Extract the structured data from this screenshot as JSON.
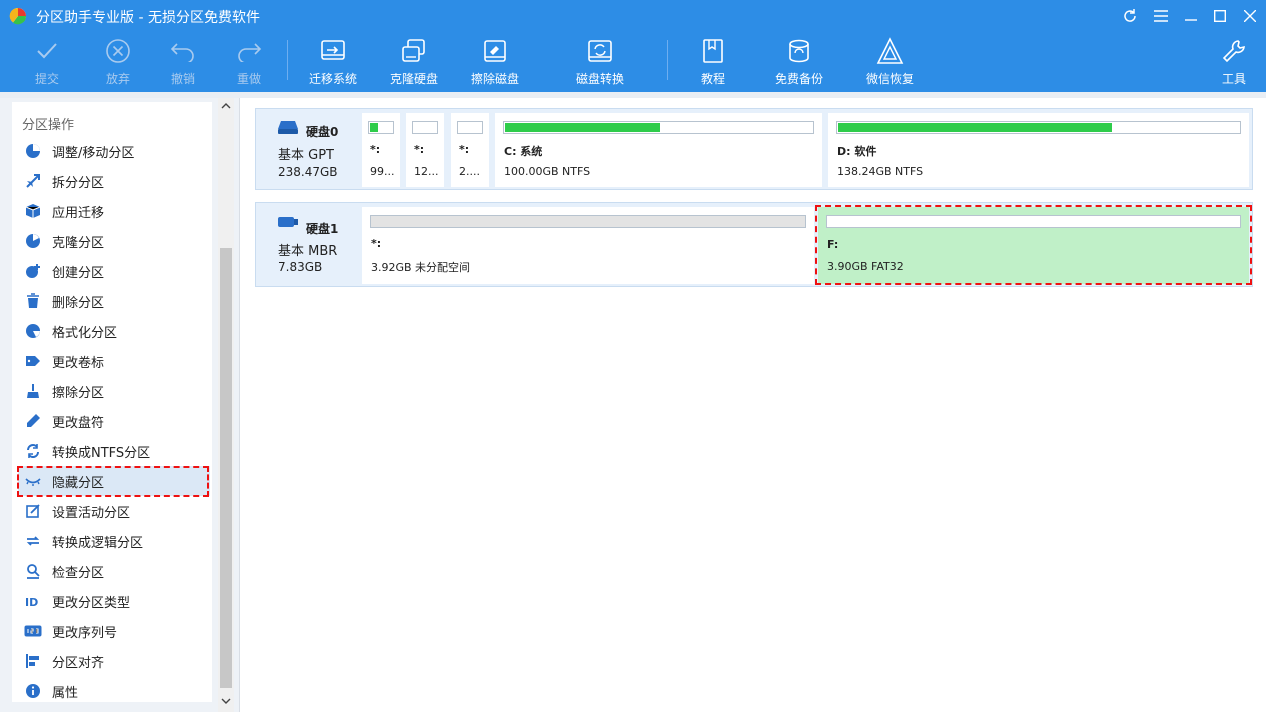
{
  "app": {
    "title": "分区助手专业版 - 无损分区免费软件"
  },
  "toolbar": {
    "buttons": [
      {
        "label": "提交",
        "icon": "check-icon",
        "enabled": false
      },
      {
        "label": "放弃",
        "icon": "cancel-circle-icon",
        "enabled": false
      },
      {
        "label": "撤销",
        "icon": "undo-icon",
        "enabled": false
      },
      {
        "label": "重做",
        "icon": "redo-icon",
        "enabled": false
      },
      {
        "label": "迁移系统",
        "icon": "migrate-os-icon",
        "enabled": true
      },
      {
        "label": "克隆硬盘",
        "icon": "clone-disk-icon",
        "enabled": true
      },
      {
        "label": "擦除磁盘",
        "icon": "wipe-disk-icon",
        "enabled": true
      },
      {
        "label": "磁盘转换",
        "icon": "disk-convert-icon",
        "enabled": true
      },
      {
        "label": "教程",
        "icon": "book-icon",
        "enabled": true
      },
      {
        "label": "免费备份",
        "icon": "backup-icon",
        "enabled": true
      },
      {
        "label": "微信恢复",
        "icon": "recovery-icon",
        "enabled": true
      },
      {
        "label": "工具",
        "icon": "tools-icon",
        "enabled": true
      }
    ]
  },
  "sidebar": {
    "title": "分区操作",
    "items": [
      {
        "label": "调整/移动分区",
        "icon": "resize-pie-icon"
      },
      {
        "label": "拆分分区",
        "icon": "split-icon"
      },
      {
        "label": "应用迁移",
        "icon": "app-move-icon"
      },
      {
        "label": "克隆分区",
        "icon": "clone-partition-icon"
      },
      {
        "label": "创建分区",
        "icon": "create-partition-icon"
      },
      {
        "label": "删除分区",
        "icon": "trash-icon"
      },
      {
        "label": "格式化分区",
        "icon": "format-icon"
      },
      {
        "label": "更改卷标",
        "icon": "tag-icon"
      },
      {
        "label": "擦除分区",
        "icon": "broom-icon"
      },
      {
        "label": "更改盘符",
        "icon": "pencil-icon"
      },
      {
        "label": "转换成NTFS分区",
        "icon": "convert-icon"
      },
      {
        "label": "隐藏分区",
        "icon": "hide-eye-icon"
      },
      {
        "label": "设置活动分区",
        "icon": "set-active-icon"
      },
      {
        "label": "转换成逻辑分区",
        "icon": "convert-logical-icon"
      },
      {
        "label": "检查分区",
        "icon": "magnifier-icon"
      },
      {
        "label": "更改分区类型",
        "icon": "id-icon"
      },
      {
        "label": "更改序列号",
        "icon": "serial-number-icon"
      },
      {
        "label": "分区对齐",
        "icon": "align-icon"
      },
      {
        "label": "属性",
        "icon": "info-icon"
      }
    ],
    "selected_index": 11
  },
  "disks": [
    {
      "name": "硬盘0",
      "type": "基本 GPT",
      "size": "238.47GB",
      "partitions": [
        {
          "label": "*:",
          "info": "99...",
          "used_fraction": 0.3
        },
        {
          "label": "*:",
          "info": "12...",
          "used_fraction": 0
        },
        {
          "label": "*:",
          "info": "2....",
          "used_fraction": 0
        },
        {
          "label": "C: 系统",
          "info": "100.00GB NTFS",
          "used_fraction": 0.5
        },
        {
          "label": "D: 软件",
          "info": "138.24GB NTFS",
          "used_fraction": 0.68
        }
      ]
    },
    {
      "name": "硬盘1",
      "type": "基本 MBR",
      "size": "7.83GB",
      "partitions": [
        {
          "label": "*:",
          "info": "3.92GB 未分配空间",
          "used_fraction": 0
        },
        {
          "label": "F:",
          "info": "3.90GB FAT32",
          "used_fraction": 0
        }
      ]
    }
  ],
  "colors": {
    "accent": "#2d8de6",
    "used_bar": "#2ecc4a",
    "selected_partition": "#c0f0c8",
    "highlight_border": "#e11111"
  }
}
